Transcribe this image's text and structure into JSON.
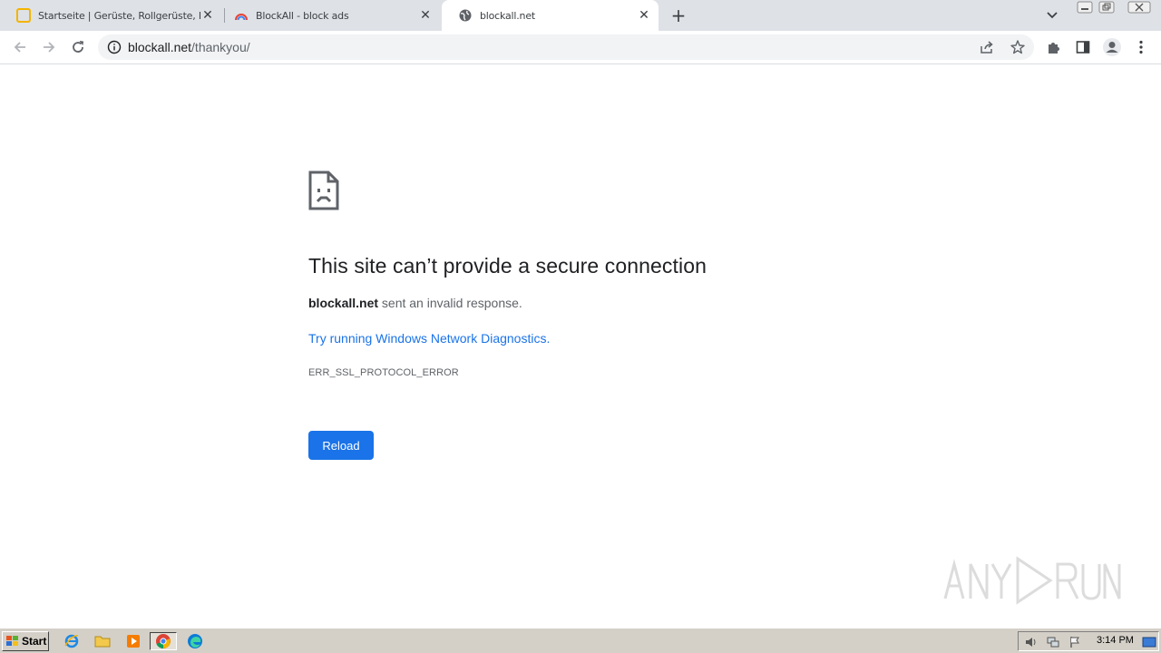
{
  "browser": {
    "tabs": [
      {
        "title": "Startseite | Gerüste, Rollgerüste, Fa",
        "favicon": "yellow-square-icon",
        "active": false
      },
      {
        "title": "BlockAll - block ads",
        "favicon": "blockall-rainbow-icon",
        "active": false
      },
      {
        "title": "blockall.net",
        "favicon": "globe-icon",
        "active": true
      }
    ],
    "new_tab_label": "+",
    "address": {
      "host": "blockall.net",
      "path": "/thankyou/"
    }
  },
  "error_page": {
    "heading": "This site can’t provide a secure connection",
    "host": "blockall.net",
    "description_rest": " sent an invalid response.",
    "diagnostics_link": "Try running Windows Network Diagnostics.",
    "error_code": "ERR_SSL_PROTOCOL_ERROR",
    "reload_label": "Reload"
  },
  "taskbar": {
    "start_label": "Start",
    "apps": [
      "internet-explorer-icon",
      "folder-icon",
      "media-player-icon",
      "chrome-icon",
      "edge-icon"
    ],
    "clock": "3:14 PM"
  },
  "colors": {
    "tabstrip_bg": "#dee1e6",
    "link": "#1a73e8",
    "button_bg": "#1a73e8",
    "taskbar_bg": "#d4d0c8"
  }
}
